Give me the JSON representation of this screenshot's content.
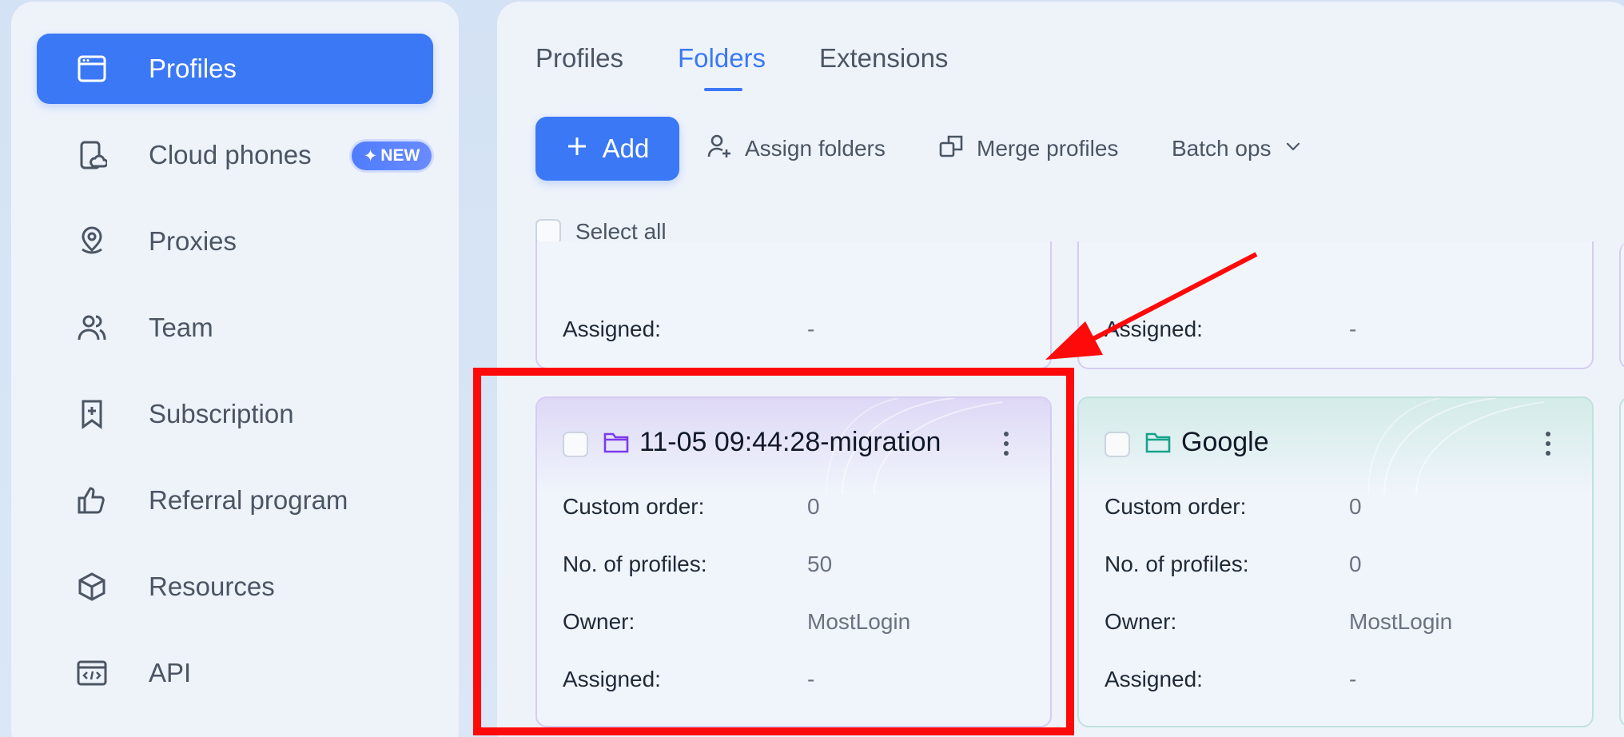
{
  "sidebar": {
    "items": [
      {
        "label": "Profiles",
        "icon": "window-icon",
        "active": true
      },
      {
        "label": "Cloud phones",
        "icon": "cloud-phone-icon",
        "badge": "NEW"
      },
      {
        "label": "Proxies",
        "icon": "location-pin-icon"
      },
      {
        "label": "Team",
        "icon": "team-icon"
      },
      {
        "label": "Subscription",
        "icon": "bookmark-plus-icon"
      },
      {
        "label": "Referral program",
        "icon": "thumbs-up-icon"
      },
      {
        "label": "Resources",
        "icon": "cube-icon"
      },
      {
        "label": "API",
        "icon": "code-window-icon"
      }
    ]
  },
  "tabs": [
    {
      "label": "Profiles"
    },
    {
      "label": "Folders",
      "active": true
    },
    {
      "label": "Extensions"
    }
  ],
  "toolbar": {
    "add_label": "Add",
    "assign_label": "Assign folders",
    "merge_label": "Merge profiles",
    "batch_label": "Batch ops"
  },
  "select_all_label": "Select all",
  "field_labels": {
    "custom_order": "Custom order:",
    "profiles": "No. of profiles:",
    "owner": "Owner:",
    "assigned": "Assigned:"
  },
  "partial_cards": [
    {
      "assigned": "-"
    },
    {
      "assigned": "-"
    }
  ],
  "cards": [
    {
      "title": "11-05 09:44:28-migration",
      "custom_order": "0",
      "profiles": "50",
      "owner": "MostLogin",
      "assigned": "-",
      "color": "#7c3aed"
    },
    {
      "title": "Google",
      "custom_order": "0",
      "profiles": "0",
      "owner": "MostLogin",
      "assigned": "-",
      "color": "#14a38b"
    }
  ],
  "colors": {
    "accent": "#3b78f6",
    "highlight": "#ff0a0a"
  }
}
